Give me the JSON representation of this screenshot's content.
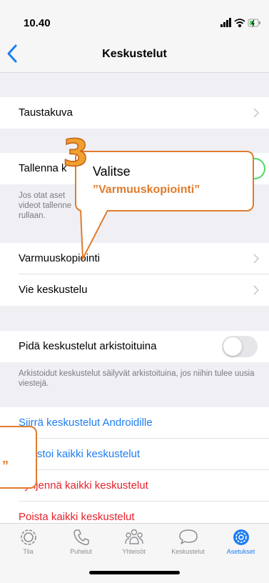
{
  "status": {
    "time": "10.40"
  },
  "nav": {
    "title": "Keskustelut"
  },
  "rows": {
    "wallpaper": "Taustakuva",
    "save_media": "Tallenna k",
    "save_media_note": "Jos otat aset\nvideot tallenne\nrullaan.",
    "backup": "Varmuuskopiointi",
    "export": "Vie keskustelu",
    "archive_toggle": "Pidä keskustelut arkistoituina",
    "archive_note": "Arkistoidut keskustelut säilyvät arkistoituina, jos niihin tulee uusia viestejä.",
    "move_android": "Siirrä keskustelut Androidille",
    "archive_all": "Arkistoi kaikki keskustelut",
    "clear_all": "Tyhjennä kaikki keskustelut",
    "delete_all": "Poista kaikki keskustelut"
  },
  "tabs": [
    {
      "label": "Tila",
      "icon": "status-icon"
    },
    {
      "label": "Puhelut",
      "icon": "phone-icon"
    },
    {
      "label": "Yhteisöt",
      "icon": "communities-icon"
    },
    {
      "label": "Keskustelut",
      "icon": "chats-icon"
    },
    {
      "label": "Asetukset",
      "icon": "settings-icon",
      "active": true
    }
  ],
  "annotation": {
    "step": "3",
    "text": "Valitse",
    "quote": "”Varmuuskopiointi”",
    "left_quote": "”"
  },
  "colors": {
    "accent": "#1d7ef2",
    "destructive": "#e4232d",
    "annotation": "#e07b2c",
    "toggle_on": "#4cd964"
  }
}
